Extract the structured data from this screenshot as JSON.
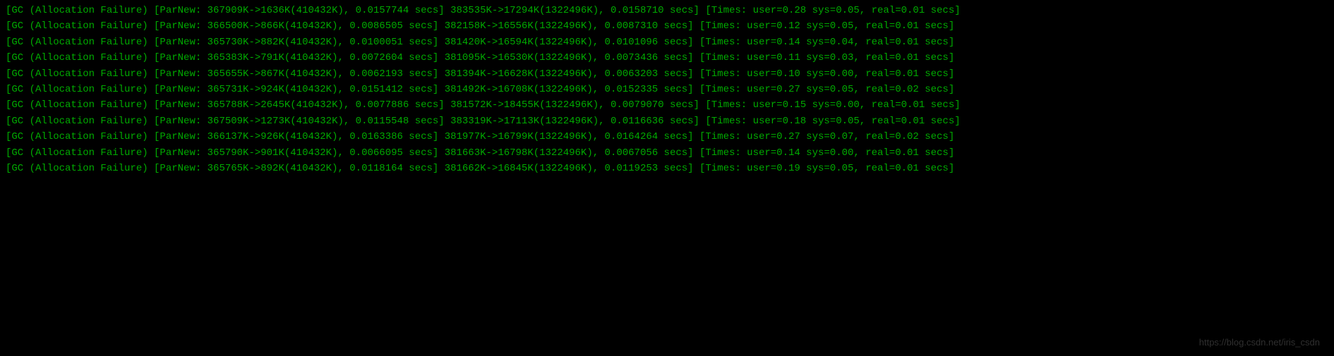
{
  "gc_logs": [
    {
      "prefix": "[GC (Allocation Failure) [ParNew: ",
      "parnew_before": "367909K",
      "parnew_after": "1636K",
      "parnew_total": "410432K",
      "parnew_time": "0.0157744 secs",
      "heap_before": "383535K",
      "heap_after": "17294K",
      "heap_total": "1322496K",
      "total_time": "0.0158710 secs",
      "user_time": "0.28",
      "sys_time": "0.05",
      "real_time": "0.01",
      "wrap_suffix": "secs]"
    },
    {
      "prefix": "[GC (Allocation Failure) [ParNew: ",
      "parnew_before": "366500K",
      "parnew_after": "866K",
      "parnew_total": "410432K",
      "parnew_time": "0.0086505 secs",
      "heap_before": "382158K",
      "heap_after": "16556K",
      "heap_total": "1322496K",
      "total_time": "0.0087310 secs",
      "user_time": "0.12",
      "sys_time": "0.05",
      "real_time": "0.01",
      "wrap_suffix": "secs]"
    },
    {
      "prefix": "[GC (Allocation Failure) [ParNew: ",
      "parnew_before": "365730K",
      "parnew_after": "882K",
      "parnew_total": "410432K",
      "parnew_time": "0.0100051 secs",
      "heap_before": "381420K",
      "heap_after": "16594K",
      "heap_total": "1322496K",
      "total_time": "0.0101096 secs",
      "user_time": "0.14",
      "sys_time": "0.04",
      "real_time": "0.01",
      "wrap_suffix": "secs]"
    },
    {
      "prefix": "[GC (Allocation Failure) [ParNew: ",
      "parnew_before": "365383K",
      "parnew_after": "791K",
      "parnew_total": "410432K",
      "parnew_time": "0.0072604 secs",
      "heap_before": "381095K",
      "heap_after": "16530K",
      "heap_total": "1322496K",
      "total_time": "0.0073436 secs",
      "user_time": "0.11",
      "sys_time": "0.03",
      "real_time": "0.01",
      "wrap_suffix": "secs]"
    },
    {
      "prefix": "[GC (Allocation Failure) [ParNew: ",
      "parnew_before": "365655K",
      "parnew_after": "867K",
      "parnew_total": "410432K",
      "parnew_time": "0.0062193 secs",
      "heap_before": "381394K",
      "heap_after": "16628K",
      "heap_total": "1322496K",
      "total_time": "0.0063203 secs",
      "user_time": "0.10",
      "sys_time": "0.00",
      "real_time": "0.01",
      "wrap_suffix": "secs]"
    },
    {
      "prefix": "[GC (Allocation Failure) [ParNew: ",
      "parnew_before": "365731K",
      "parnew_after": "924K",
      "parnew_total": "410432K",
      "parnew_time": "0.0151412 secs",
      "heap_before": "381492K",
      "heap_after": "16708K",
      "heap_total": "1322496K",
      "total_time": "0.0152335 secs",
      "user_time": "0.27",
      "sys_time": "0.05",
      "real_time": "0.02",
      "wrap_suffix": "secs]"
    },
    {
      "prefix": "[GC (Allocation Failure) [ParNew: ",
      "parnew_before": "365788K",
      "parnew_after": "2645K",
      "parnew_total": "410432K",
      "parnew_time": "0.0077886 secs",
      "heap_before": "381572K",
      "heap_after": "18455K",
      "heap_total": "1322496K",
      "total_time": "0.0079070 secs",
      "user_time": "0.15",
      "sys_time": "0.00",
      "real_time": "0.01",
      "wrap_suffix": "secs]"
    },
    {
      "prefix": "[GC (Allocation Failure) [ParNew: ",
      "parnew_before": "367509K",
      "parnew_after": "1273K",
      "parnew_total": "410432K",
      "parnew_time": "0.0115548 secs",
      "heap_before": "383319K",
      "heap_after": "17113K",
      "heap_total": "1322496K",
      "total_time": "0.0116636 secs",
      "user_time": "0.18",
      "sys_time": "0.05",
      "real_time": "0.01",
      "wrap_suffix": "secs]"
    },
    {
      "prefix": "[GC (Allocation Failure) [ParNew: ",
      "parnew_before": "366137K",
      "parnew_after": "926K",
      "parnew_total": "410432K",
      "parnew_time": "0.0163386 secs",
      "heap_before": "381977K",
      "heap_after": "16799K",
      "heap_total": "1322496K",
      "total_time": "0.0164264 secs",
      "user_time": "0.27",
      "sys_time": "0.07",
      "real_time": "0.02",
      "wrap_suffix": "secs]"
    },
    {
      "prefix": "[GC (Allocation Failure) [ParNew: ",
      "parnew_before": "365790K",
      "parnew_after": "901K",
      "parnew_total": "410432K",
      "parnew_time": "0.0066095 secs",
      "heap_before": "381663K",
      "heap_after": "16798K",
      "heap_total": "1322496K",
      "total_time": "0.0067056 secs",
      "user_time": "0.14",
      "sys_time": "0.00",
      "real_time": "0.01",
      "wrap_suffix": "secs]"
    },
    {
      "prefix": "[GC (Allocation Failure) [ParNew: ",
      "parnew_before": "365765K",
      "parnew_after": "892K",
      "parnew_total": "410432K",
      "parnew_time": "0.0118164 secs",
      "heap_before": "381662K",
      "heap_after": "16845K",
      "heap_total": "1322496K",
      "total_time": "0.0119253 secs",
      "user_time": "0.19",
      "sys_time": "0.05",
      "real_time": "0.01",
      "wrap_suffix": "secs]"
    }
  ],
  "watermark": "https://blog.csdn.net/iris_csdn"
}
